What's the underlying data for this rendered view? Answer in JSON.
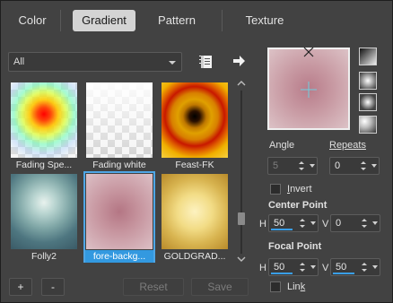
{
  "tabs": [
    {
      "label": "Color",
      "active": false
    },
    {
      "label": "Gradient",
      "active": true
    },
    {
      "label": "Pattern",
      "active": false
    },
    {
      "label": "Texture",
      "active": false
    }
  ],
  "library": {
    "selected": "All"
  },
  "gradients": [
    {
      "label": "Fading Spe...",
      "selected": false
    },
    {
      "label": "Fading white",
      "selected": false
    },
    {
      "label": "Feast-FK",
      "selected": false
    },
    {
      "label": "Folly2",
      "selected": false
    },
    {
      "label": "fore-backg...",
      "selected": true
    },
    {
      "label": "GOLDGRAD...",
      "selected": false
    }
  ],
  "bottom_buttons": {
    "add": "+",
    "remove": "-",
    "reset": "Reset",
    "save": "Save"
  },
  "properties": {
    "angle_label": "Angle",
    "angle_value": "5",
    "repeats_label": "Repeats",
    "repeats_value": "0",
    "invert_label": "Invert",
    "invert_checked": false,
    "center_point_label": "Center Point",
    "center_h_label": "H",
    "center_h_value": "50",
    "center_v_label": "V",
    "center_v_value": "0",
    "focal_point_label": "Focal Point",
    "focal_h_label": "H",
    "focal_h_value": "50",
    "focal_v_label": "V",
    "focal_v_value": "50",
    "link_label": "Link",
    "link_checked": false
  },
  "colors": {
    "accent": "#3a9ee6",
    "background": "#424242",
    "selected_label": "#3399e0"
  },
  "icons": {
    "library_menu": "book-menu-icon",
    "navigate": "arrow-right-icon",
    "styles": [
      "linear-style-icon",
      "radial-style-icon",
      "rectangular-style-icon",
      "sunburst-style-icon"
    ]
  }
}
